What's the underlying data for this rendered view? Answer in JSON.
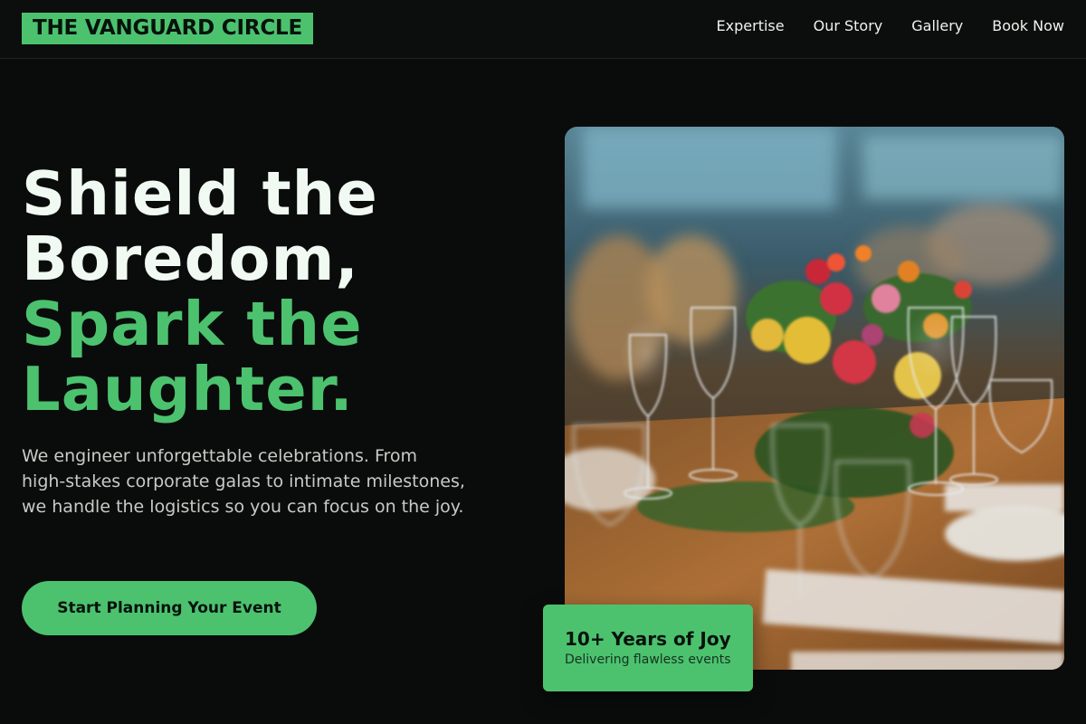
{
  "brand": {
    "name": "THE VANGUARD CIRCLE",
    "accent_color": "#4cc26f",
    "background_color": "#0a0c0b"
  },
  "nav": {
    "items": [
      {
        "label": "Expertise"
      },
      {
        "label": "Our Story"
      },
      {
        "label": "Gallery"
      },
      {
        "label": "Book Now"
      }
    ]
  },
  "hero": {
    "title_lines": [
      {
        "text": "Shield the",
        "style": "light"
      },
      {
        "text": "Boredom,",
        "style": "light"
      },
      {
        "text": "Spark the",
        "style": "accent"
      },
      {
        "text": "Laughter.",
        "style": "accent"
      }
    ],
    "description": "We engineer unforgettable celebrations. From high-stakes corporate galas to intimate milestones, we handle the logistics so you can focus on the joy.",
    "cta_label": "Start Planning Your Event",
    "image_subject": "banquet table with wine glasses and flower centerpiece"
  },
  "badge": {
    "title": "10+ Years of Joy",
    "subtitle": "Delivering flawless events"
  }
}
